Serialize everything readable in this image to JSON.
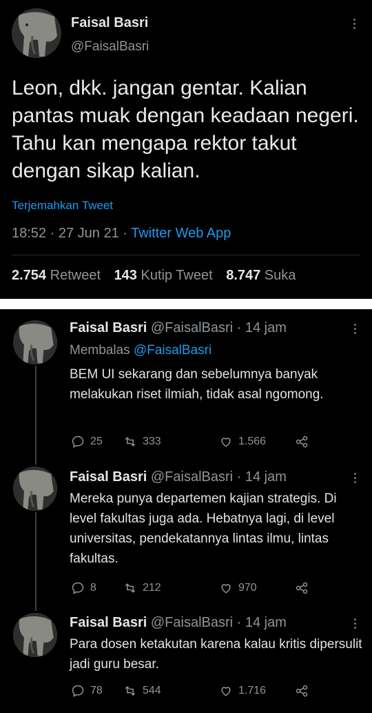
{
  "main_tweet": {
    "author_name": "Faisal Basri",
    "author_handle": "@FaisalBasri",
    "text": "Leon, dkk. jangan gentar. Kalian pantas muak dengan keadaan negeri. Tahu kan mengapa rektor takut dengan sikap kalian.",
    "translate_label": "Terjemahkan Tweet",
    "time": "18:52",
    "date": "27 Jun 21",
    "source": "Twitter Web App",
    "retweets_count": "2.754",
    "retweets_label": "Retweet",
    "quotes_count": "143",
    "quotes_label": "Kutip Tweet",
    "likes_count": "8.747",
    "likes_label": "Suka"
  },
  "thread": [
    {
      "name": "Faisal Basri",
      "handle": "@FaisalBasri",
      "time": "14 jam",
      "reply_prefix": "Membalas",
      "reply_to": "@FaisalBasri",
      "text": "BEM UI sekarang dan sebelumnya banyak melakukan riset ilmiah, tidak asal ngomong.",
      "replies": "25",
      "retweets": "333",
      "likes": "1.566"
    },
    {
      "name": "Faisal Basri",
      "handle": "@FaisalBasri",
      "time": "14 jam",
      "text": "Mereka punya departemen kajian strategis. Di level fakultas juga ada. Hebatnya lagi, di level universitas, pendekatannya lintas ilmu, lintas fakultas.",
      "replies": "8",
      "retweets": "212",
      "likes": "970"
    },
    {
      "name": "Faisal Basri",
      "handle": "@FaisalBasri",
      "time": "14 jam",
      "text": "Para dosen ketakutan karena kalau kritis dipersulit jadi guru besar.",
      "replies": "78",
      "retweets": "544",
      "likes": "1.716"
    }
  ],
  "icons": {
    "reply": "comment-icon",
    "retweet": "retweet-icon",
    "like": "heart-icon",
    "share": "share-icon",
    "more": "more-vertical-icon"
  },
  "colors": {
    "background": "#000000",
    "accent": "#1d9bf0",
    "secondary_text": "#8f959a",
    "primary_text": "#e7e7e7"
  }
}
